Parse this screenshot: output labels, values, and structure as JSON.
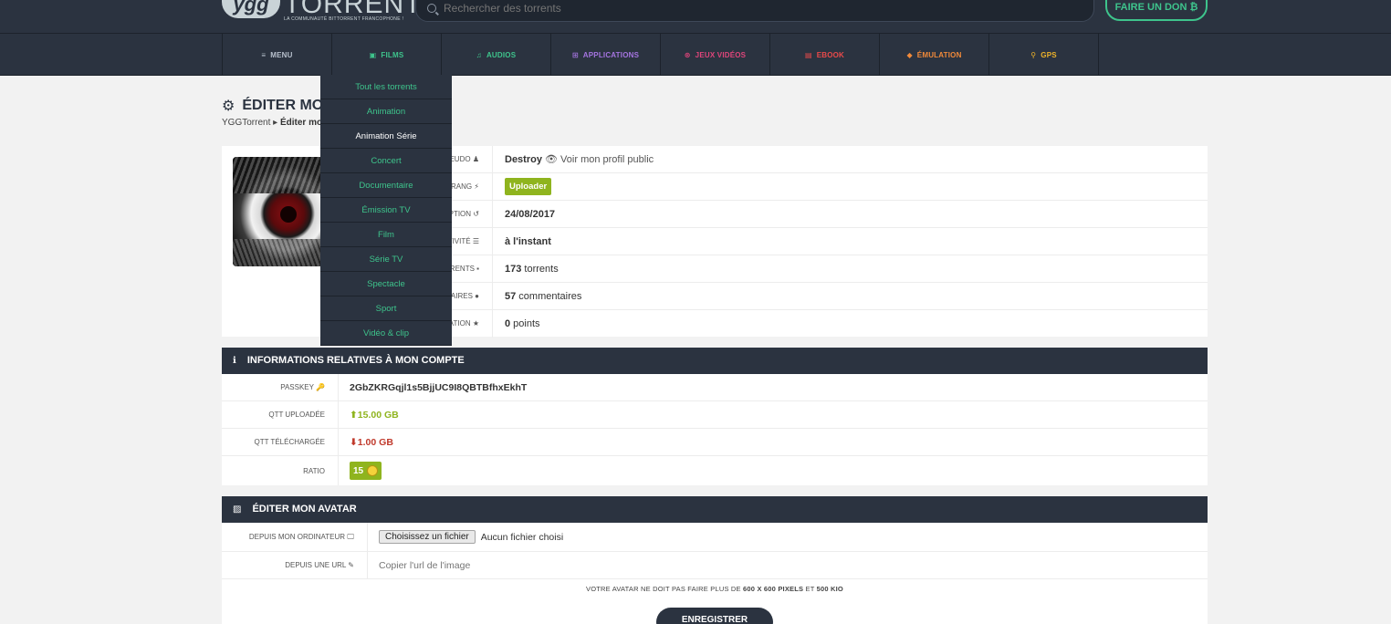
{
  "header": {
    "logo_short": "ygg",
    "logo_name": "TORRENT",
    "logo_tagline": "LA COMMUNAUTÉ BITTORRENT FRANCOPHONE !",
    "search_placeholder": "Rechercher des torrents",
    "donate_label": "FAIRE UN DON ₿"
  },
  "nav": {
    "items": [
      {
        "label": "MENU",
        "icon": "≡",
        "color": "#b7c0cc"
      },
      {
        "label": "FILMS",
        "icon": "▣",
        "color": "#3ec48c"
      },
      {
        "label": "AUDIOS",
        "icon": "♫",
        "color": "#3ec48c"
      },
      {
        "label": "APPLICATIONS",
        "icon": "⊞",
        "color": "#a574e0"
      },
      {
        "label": "JEUX VIDÉOS",
        "icon": "⊛",
        "color": "#e0457b"
      },
      {
        "label": "EBOOK",
        "icon": "▤",
        "color": "#ea4a4a"
      },
      {
        "label": "ÉMULATION",
        "icon": "◆",
        "color": "#f28a3a"
      },
      {
        "label": "GPS",
        "icon": "⚲",
        "color": "#f0b429"
      }
    ]
  },
  "dropdown": {
    "items": [
      "Tout les torrents",
      "Animation",
      "Animation Série",
      "Concert",
      "Documentaire",
      "Émission TV",
      "Film",
      "Série TV",
      "Spectacle",
      "Sport",
      "Vidéo & clip"
    ],
    "active": "Animation Série"
  },
  "page": {
    "title": "ÉDITER MON PROFIL",
    "breadcrumb_root": "YGGTorrent",
    "breadcrumb_current": "Éditer mon profil"
  },
  "profile": {
    "rows": [
      {
        "label": "PSEUDO",
        "icon": "♟",
        "value": "Destroy",
        "extra": "👁 Voir mon profil public"
      },
      {
        "label": "RANG",
        "icon": "⚡",
        "value": "Uploader"
      },
      {
        "label": "INSCRIPTION",
        "icon": "↺",
        "value": "24/08/2017"
      },
      {
        "label": "ACTIVITÉ",
        "icon": "☰",
        "value": "à l'instant"
      },
      {
        "label": "TORRENTS",
        "icon": "▪",
        "value_num": "173",
        "value_text": " torrents"
      },
      {
        "label": "COMMENTAIRES",
        "icon": "●",
        "value_num": "57",
        "value_text": " commentaires"
      },
      {
        "label": "RÉPUTATION",
        "icon": "★",
        "value_num": "0",
        "value_text": " points"
      }
    ]
  },
  "account": {
    "title": "INFORMATIONS RELATIVES À MON COMPTE",
    "passkey_label": "PASSKEY 🔑",
    "passkey_value": "2GbZKRGqjl1s5BjjUC9I8QBTBfhxEkhT",
    "uploaded_label": "QTT UPLOADÉE",
    "uploaded_value": "⬆15.00 GB",
    "downloaded_label": "QTT TÉLÉCHARGÉE",
    "downloaded_value": "⬇1.00 GB",
    "ratio_label": "RATIO",
    "ratio_value": "15"
  },
  "avatar_edit": {
    "title": "ÉDITER MON AVATAR",
    "computer_label": "DEPUIS MON ORDINATEUR 🖵",
    "file_button": "Choisissez un fichier",
    "no_file": "Aucun fichier choisi",
    "url_label": "DEPUIS UNE URL ✎",
    "url_placeholder": "Copier l'url de l'image",
    "note_prefix": "VOTRE AVATAR NE DOIT PAS FAIRE PLUS DE ",
    "note_size": "600 X 600 PIXELS",
    "note_mid": " ET ",
    "note_weight": "500 KIO",
    "save_label": "ENREGISTRER"
  }
}
